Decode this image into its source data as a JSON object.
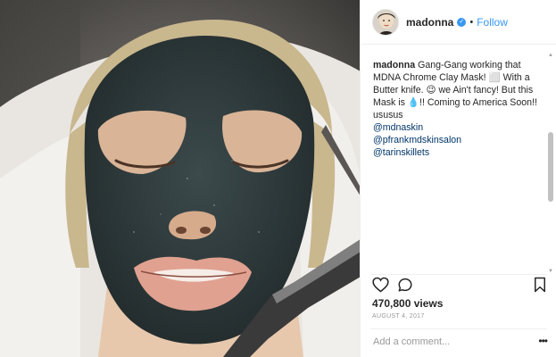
{
  "post": {
    "username": "madonna",
    "verified_icon": "verified-badge-icon",
    "separator": "•",
    "follow_label": "Follow",
    "caption_user": "madonna",
    "caption_line1": "Gang-Gang working that MDNA Chrome Clay Mask! ⬜ With a Butter knife. 😉 we Ain't fancy! But this Mask is 💧!! Coming to America Soon!! ususus",
    "mentions": [
      "@mdnaskin",
      "@pfrankmdskinsalon",
      "@tarinskillets"
    ],
    "views": "470,800 views",
    "date": "AUGUST 4, 2017",
    "comment_placeholder": "Add a comment...",
    "more_label": "•••"
  },
  "icons": {
    "like": "heart-icon",
    "comment": "comment-icon",
    "save": "bookmark-icon",
    "more": "more-options-icon"
  },
  "colors": {
    "link_blue": "#3897f0",
    "mention_blue": "#003569",
    "text": "#262626",
    "muted": "#999999",
    "mask_dark": "#2f3b3c"
  }
}
